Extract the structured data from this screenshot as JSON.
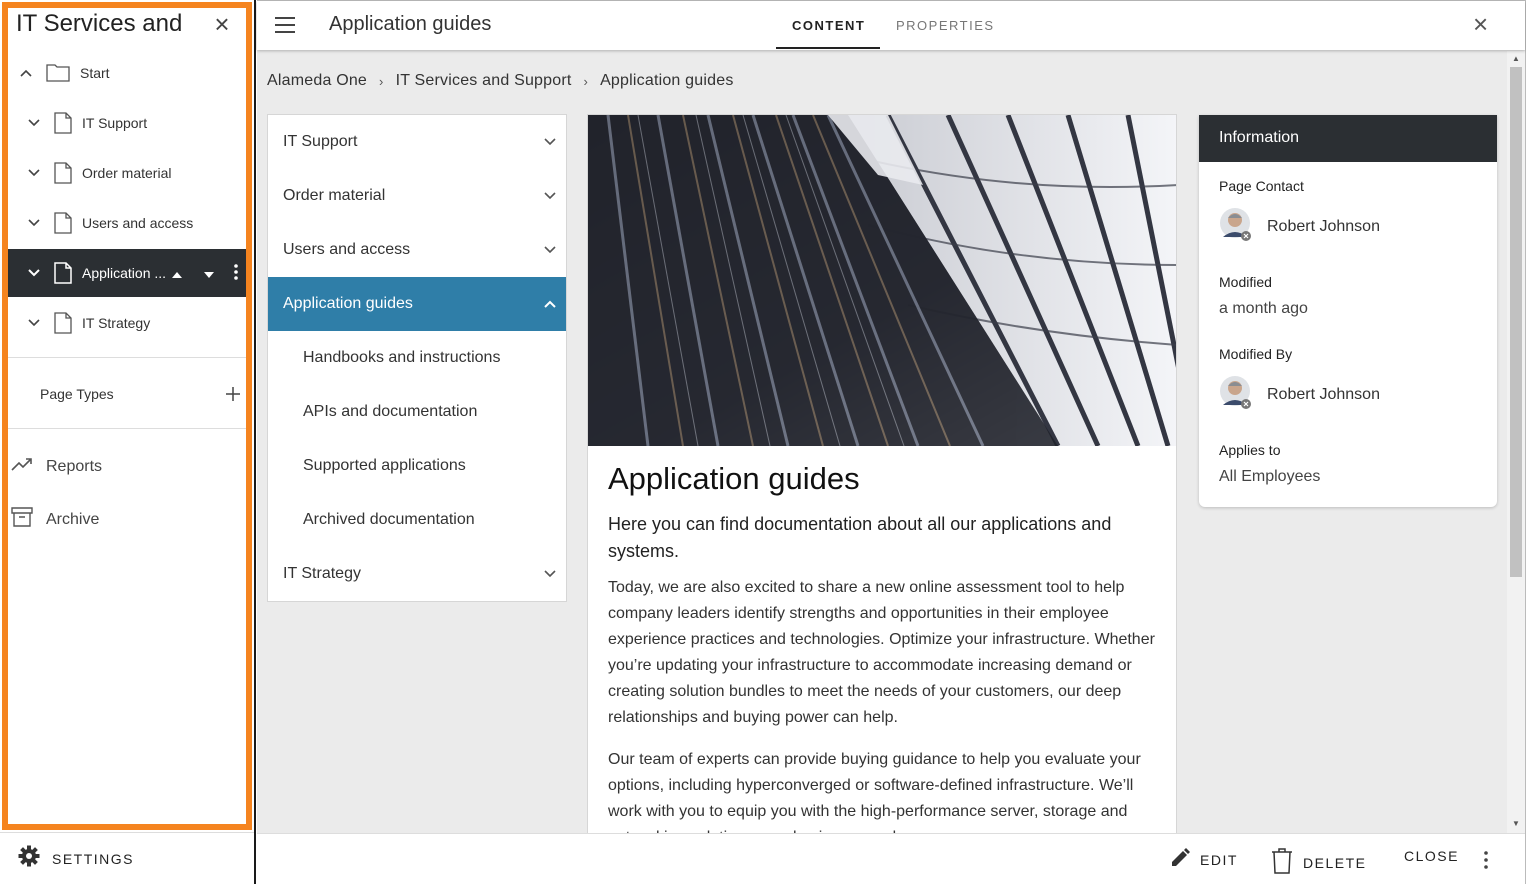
{
  "left_panel": {
    "title": "IT Services and Support",
    "tree": [
      {
        "label": "Start",
        "icon": "folder-icon",
        "level": 0
      },
      {
        "label": "IT Support",
        "icon": "document-icon",
        "level": 1
      },
      {
        "label": "Order material",
        "icon": "document-icon",
        "level": 1
      },
      {
        "label": "Users and access",
        "icon": "document-icon",
        "level": 1
      },
      {
        "label": "Application ...",
        "icon": "document-icon",
        "level": 1,
        "active": true
      },
      {
        "label": "IT Strategy",
        "icon": "document-icon",
        "level": 1
      }
    ],
    "page_types_label": "Page Types",
    "nav": [
      {
        "label": "Reports",
        "icon": "trending-icon"
      },
      {
        "label": "Archive",
        "icon": "archive-icon"
      }
    ],
    "settings_label": "SETTINGS"
  },
  "topbar": {
    "title": "Application guides",
    "tabs": [
      "CONTENT",
      "PROPERTIES"
    ]
  },
  "breadcrumb": [
    "Alameda One",
    "IT Services and Support",
    "Application guides"
  ],
  "section_nav": {
    "items": [
      {
        "label": "IT Support",
        "expandable": true
      },
      {
        "label": "Order material",
        "expandable": true
      },
      {
        "label": "Users and access",
        "expandable": true
      },
      {
        "label": "Application guides",
        "expandable": true,
        "active": true
      },
      {
        "label": "Handbooks and instructions",
        "sub": true
      },
      {
        "label": "APIs and documentation",
        "sub": true
      },
      {
        "label": "Supported applications",
        "sub": true
      },
      {
        "label": "Archived documentation",
        "sub": true
      },
      {
        "label": "IT Strategy",
        "expandable": true
      }
    ]
  },
  "article": {
    "title": "Application guides",
    "lead": "Here you can find documentation about all our applications and systems.",
    "paragraphs": [
      "Today, we are also excited to share a new online assessment tool to help company leaders identify strengths and opportunities in their employee experience practices and technologies. Optimize your infrastructure. Whether you’re updating your infrastructure to accommodate increasing demand or creating solution bundles to meet the needs of your customers, our deep relationships and buying power can help.",
      "Our team of experts can provide buying guidance to help you evaluate your options, including hyperconverged or software-defined infrastructure. We’ll work with you to equip you with the high-performance server, storage and networking solutions your business needs."
    ]
  },
  "info": {
    "header": "Information",
    "page_contact_label": "Page Contact",
    "page_contact_name": "Robert Johnson",
    "modified_label": "Modified",
    "modified_value": "a month ago",
    "modified_by_label": "Modified By",
    "modified_by_name": "Robert Johnson",
    "applies_to_label": "Applies to",
    "applies_to_value": "All Employees"
  },
  "bottombar": {
    "edit": "EDIT",
    "delete": "DELETE",
    "close": "CLOSE"
  },
  "colors": {
    "highlight": "#f5841f",
    "active_nav": "#2f7ea8",
    "dark_header": "#2b2f33"
  }
}
